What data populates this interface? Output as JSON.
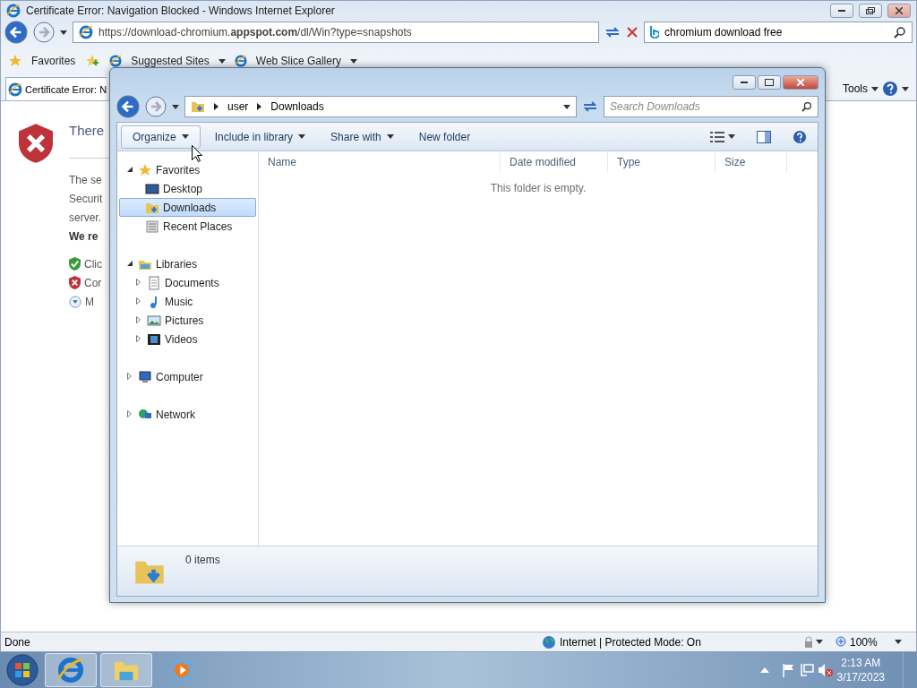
{
  "browser": {
    "title": "Certificate Error: Navigation Blocked - Windows Internet Explorer",
    "url": "https://download-chromium.**appspot.com**/dl/Win?type=snapshots",
    "search_value": "chromium download free",
    "favorites_label": "Favorites",
    "favorite_links": [
      "Suggested Sites",
      "Web Slice Gallery"
    ],
    "tab": {
      "title": "Certificate Error: N",
      "selected": true
    },
    "tools_label": "Tools",
    "page": {
      "heading": "There",
      "lines": [
        {
          "kind": "text",
          "text": "The se"
        },
        {
          "kind": "text",
          "text": "Securit"
        },
        {
          "kind": "text",
          "text": "server."
        },
        {
          "kind": "bold",
          "text": "We re"
        },
        {
          "kind": "safe",
          "text": "Clic"
        },
        {
          "kind": "danger",
          "text": "Cor"
        },
        {
          "kind": "more",
          "text": "M"
        }
      ]
    },
    "status": "Done",
    "zone": "Internet | Protected Mode: On",
    "zoom": "100%"
  },
  "explorer": {
    "breadcrumb": [
      "user",
      "Downloads"
    ],
    "search_placeholder": "Search Downloads",
    "toolbar": [
      {
        "label": "Organize",
        "dropdown": true
      },
      {
        "label": "Include in library",
        "dropdown": true
      },
      {
        "label": "Share with",
        "dropdown": true
      },
      {
        "label": "New folder",
        "dropdown": false
      }
    ],
    "nav": [
      {
        "label": "Favorites",
        "expanded": true,
        "children": [
          {
            "label": "Desktop",
            "selected": false
          },
          {
            "label": "Downloads",
            "selected": true
          },
          {
            "label": "Recent Places",
            "selected": false
          }
        ]
      },
      {
        "label": "Libraries",
        "expanded": true,
        "children": [
          {
            "label": "Documents",
            "expanded": false,
            "selected": false
          },
          {
            "label": "Music",
            "expanded": false,
            "selected": false
          },
          {
            "label": "Pictures",
            "expanded": false,
            "selected": false
          },
          {
            "label": "Videos",
            "expanded": false,
            "selected": false
          }
        ]
      },
      {
        "label": "Computer",
        "expanded": false
      },
      {
        "label": "Network",
        "expanded": false
      }
    ],
    "columns": [
      "Name",
      "Date modified",
      "Type",
      "Size"
    ],
    "empty_message": "This folder is empty.",
    "item_count": "0 items"
  },
  "taskbar": {
    "apps": [
      {
        "kind": "ie",
        "selected": true
      },
      {
        "kind": "explorer",
        "selected": true
      },
      {
        "kind": "media",
        "selected": false
      }
    ],
    "time": "2:13 AM",
    "date": "3/17/2023"
  }
}
